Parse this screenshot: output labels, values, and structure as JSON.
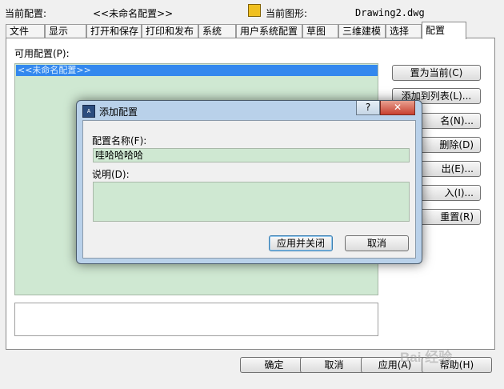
{
  "header": {
    "current_config_label": "当前配置:",
    "current_config_value": "<<未命名配置>>",
    "current_drawing_label": "当前图形:",
    "current_drawing_value": "Drawing2.dwg"
  },
  "tabs": [
    {
      "label": "文件"
    },
    {
      "label": "显示"
    },
    {
      "label": "打开和保存"
    },
    {
      "label": "打印和发布"
    },
    {
      "label": "系统"
    },
    {
      "label": "用户系统配置"
    },
    {
      "label": "草图"
    },
    {
      "label": "三维建模"
    },
    {
      "label": "选择"
    },
    {
      "label": "配置",
      "active": true
    }
  ],
  "profiles": {
    "label": "可用配置(P):",
    "items": [
      "<<未命名配置>>"
    ]
  },
  "side_buttons": {
    "set_current": "置为当前(C)",
    "add_to_list": "添加到列表(L)...",
    "rename": "名(N)...",
    "delete": "删除(D)",
    "export": "出(E)...",
    "import": "入(I)...",
    "reset": "重置(R)"
  },
  "bottom_buttons": {
    "ok": "确定",
    "cancel": "取消",
    "apply": "应用(A)",
    "help": "帮助(H)"
  },
  "dialog": {
    "title": "添加配置",
    "help_glyph": "?",
    "close_glyph": "✕",
    "name_label": "配置名称(F):",
    "name_value": "哇哈哈哈哈",
    "desc_label": "说明(D):",
    "desc_value": "",
    "apply_close": "应用并关闭",
    "cancel": "取消"
  },
  "watermark": "Bai 经验"
}
